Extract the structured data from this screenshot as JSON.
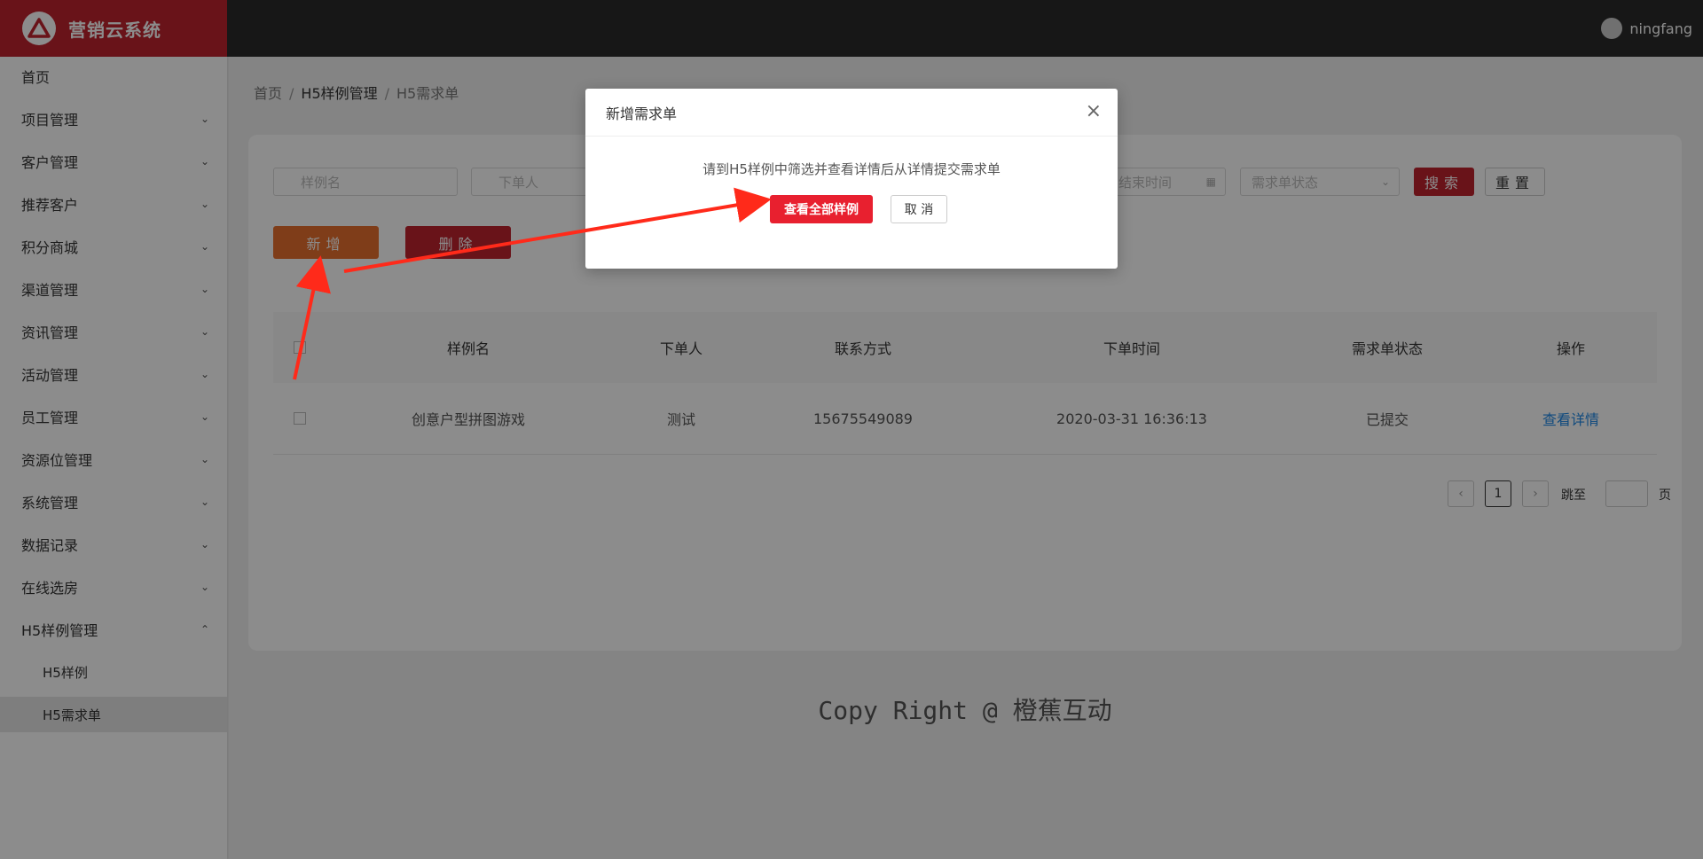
{
  "app": {
    "title": "营销云系统",
    "user": "ningfang"
  },
  "sidebar": {
    "items": [
      {
        "label": "首页",
        "expandable": false
      },
      {
        "label": "项目管理",
        "expandable": true
      },
      {
        "label": "客户管理",
        "expandable": true
      },
      {
        "label": "推荐客户",
        "expandable": true
      },
      {
        "label": "积分商城",
        "expandable": true
      },
      {
        "label": "渠道管理",
        "expandable": true
      },
      {
        "label": "资讯管理",
        "expandable": true
      },
      {
        "label": "活动管理",
        "expandable": true
      },
      {
        "label": "员工管理",
        "expandable": true
      },
      {
        "label": "资源位管理",
        "expandable": true
      },
      {
        "label": "系统管理",
        "expandable": true
      },
      {
        "label": "数据记录",
        "expandable": true
      },
      {
        "label": "在线选房",
        "expandable": true
      },
      {
        "label": "H5样例管理",
        "expandable": true,
        "expanded": true
      }
    ],
    "subitems": [
      {
        "label": "H5样例"
      },
      {
        "label": "H5需求单",
        "active": true
      }
    ],
    "chevron_down": "⌄",
    "chevron_up": "⌃"
  },
  "breadcrumb": {
    "items": [
      "首页",
      "H5样例管理",
      "H5需求单"
    ],
    "separator": "/"
  },
  "filters": {
    "sample_name_placeholder": "样例名",
    "orderer_placeholder": "下单人",
    "end_time_placeholder": "结束时间",
    "status_placeholder": "需求单状态",
    "search_label": "搜索",
    "reset_label": "重置"
  },
  "actions": {
    "add_label": "新增",
    "delete_label": "删除"
  },
  "table": {
    "headers": [
      "样例名",
      "下单人",
      "联系方式",
      "下单时间",
      "需求单状态",
      "操作"
    ],
    "rows": [
      {
        "sample_name": "创意户型拼图游戏",
        "orderer": "测试",
        "contact": "15675549089",
        "order_time": "2020-03-31 16:36:13",
        "status": "已提交",
        "action": "查看详情"
      }
    ]
  },
  "pagination": {
    "prev": "‹",
    "current": "1",
    "next": "›",
    "jump_label": "跳至",
    "page_unit": "页"
  },
  "footer": {
    "text": "Copy Right @ 橙蕉互动"
  },
  "modal": {
    "title": "新增需求单",
    "message": "请到H5样例中筛选并查看详情后从详情提交需求单",
    "primary_label": "查看全部样例",
    "cancel_label": "取 消",
    "close": "×"
  },
  "colors": {
    "brand": "#c0232f",
    "orange": "#e8702e",
    "link": "#1e88e5",
    "annotation_arrow": "#ff2a1a"
  }
}
